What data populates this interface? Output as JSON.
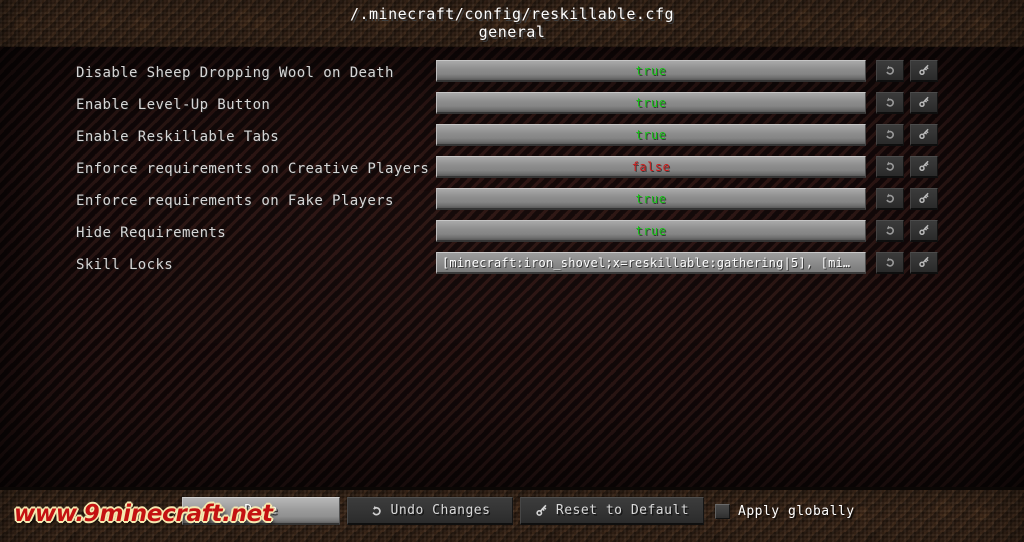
{
  "header": {
    "file_path": "/.minecraft/config/reskillable.cfg",
    "category": "general"
  },
  "options": [
    {
      "label": "Disable Sheep Dropping Wool on Death",
      "value": "true",
      "value_type": "boolean",
      "value_state": "true"
    },
    {
      "label": "Enable Level-Up Button",
      "value": "true",
      "value_type": "boolean",
      "value_state": "true"
    },
    {
      "label": "Enable Reskillable Tabs",
      "value": "true",
      "value_type": "boolean",
      "value_state": "true"
    },
    {
      "label": "Enforce requirements on Creative Players",
      "value": "false",
      "value_type": "boolean",
      "value_state": "false"
    },
    {
      "label": "Enforce requirements on Fake Players",
      "value": "true",
      "value_type": "boolean",
      "value_state": "true"
    },
    {
      "label": "Hide Requirements",
      "value": "true",
      "value_type": "boolean",
      "value_state": "true"
    },
    {
      "label": "Skill Locks",
      "value": "[minecraft:iron_shovel;x=reskillable:gathering|5], [mi…",
      "value_type": "text",
      "value_state": "text"
    }
  ],
  "row_buttons": {
    "undo_icon": "undo-arrow-icon",
    "reset_icon": "key-icon"
  },
  "footer": {
    "done_label": "Done",
    "undo_label": "Undo Changes",
    "undo_icon": "undo-arrow-icon",
    "reset_label": "Reset to Default",
    "reset_icon": "key-icon",
    "apply_globally_label": "Apply globally",
    "apply_globally_checked": false
  },
  "watermark": {
    "text": "www.9minecraft.net"
  },
  "colors": {
    "true_color": "#17c217",
    "false_color": "#cc2020",
    "dirt": "#392518",
    "panel": "#14090a",
    "watermark_fill": "#c41212",
    "watermark_outline": "#f5e9b0"
  }
}
